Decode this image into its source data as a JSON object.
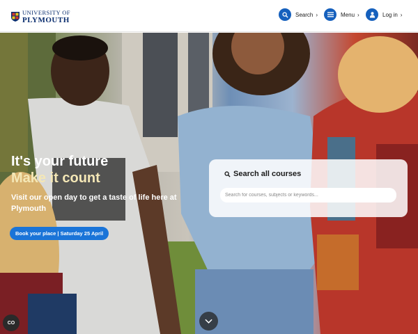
{
  "header": {
    "logo_top": "UNIVERSITY OF",
    "logo_bottom": "PLYMOUTH",
    "nav": [
      {
        "label": "Search",
        "icon": "search-icon"
      },
      {
        "label": "Menu",
        "icon": "menu-icon"
      },
      {
        "label": "Log in",
        "icon": "user-icon"
      }
    ]
  },
  "hero": {
    "title_line1": "It's your future",
    "title_line2": "Make it count",
    "subtitle": "Visit our open day to get a taste of life here at Plymouth",
    "cta_label": "Book your place | Saturday 25 April"
  },
  "course_search": {
    "title": "Search all courses",
    "placeholder": "Search for courses, subjects or keywords..."
  },
  "controls": {
    "cc_label": "CO",
    "scroll_icon": "chevron-down-icon"
  },
  "colors": {
    "brand_blue": "#1560bd",
    "navy": "#0a2d6e",
    "cta_blue": "#1a74d8",
    "hero_accent": "#f4e7b6"
  }
}
